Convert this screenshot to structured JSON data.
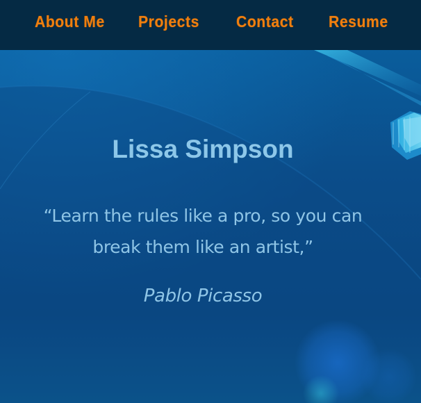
{
  "nav": {
    "items": [
      {
        "label": "About Me"
      },
      {
        "label": "Projects"
      },
      {
        "label": "Contact"
      },
      {
        "label": "Resume"
      }
    ]
  },
  "hero": {
    "name": "Lissa Simpson",
    "quote": "“Learn the rules like a pro, so you can break them like an artist,”",
    "author": "Pablo Picasso"
  },
  "colors": {
    "nav_background": "#052a44",
    "nav_link": "#ef7f0f",
    "hero_background": "#0a5290",
    "hero_text": "#8fc5e6"
  }
}
